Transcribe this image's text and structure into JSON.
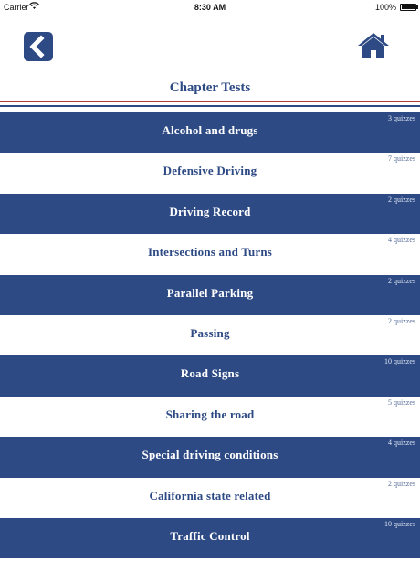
{
  "status_bar": {
    "carrier": "Carrier",
    "time": "8:30 AM",
    "battery": "100%"
  },
  "header": {
    "title": "Chapter Tests",
    "back_icon": "chevron-left-icon",
    "home_icon": "home-icon"
  },
  "colors": {
    "primary": "#2d4a84",
    "accent_red": "#b13a3a"
  },
  "chapters": [
    {
      "name": "Alcohol and drugs",
      "count": "3 quizzes"
    },
    {
      "name": "Defensive Driving",
      "count": "7 quizzes"
    },
    {
      "name": "Driving Record",
      "count": "2 quizzes"
    },
    {
      "name": "Intersections and Turns",
      "count": "4 quizzes"
    },
    {
      "name": "Parallel Parking",
      "count": "2 quizzes"
    },
    {
      "name": "Passing",
      "count": "2 quizzes"
    },
    {
      "name": "Road Signs",
      "count": "10 quizzes"
    },
    {
      "name": "Sharing the road",
      "count": "5 quizzes"
    },
    {
      "name": "Special driving conditions",
      "count": "4 quizzes"
    },
    {
      "name": "California state related",
      "count": "2 quizzes"
    },
    {
      "name": "Traffic Control",
      "count": "10 quizzes"
    }
  ]
}
